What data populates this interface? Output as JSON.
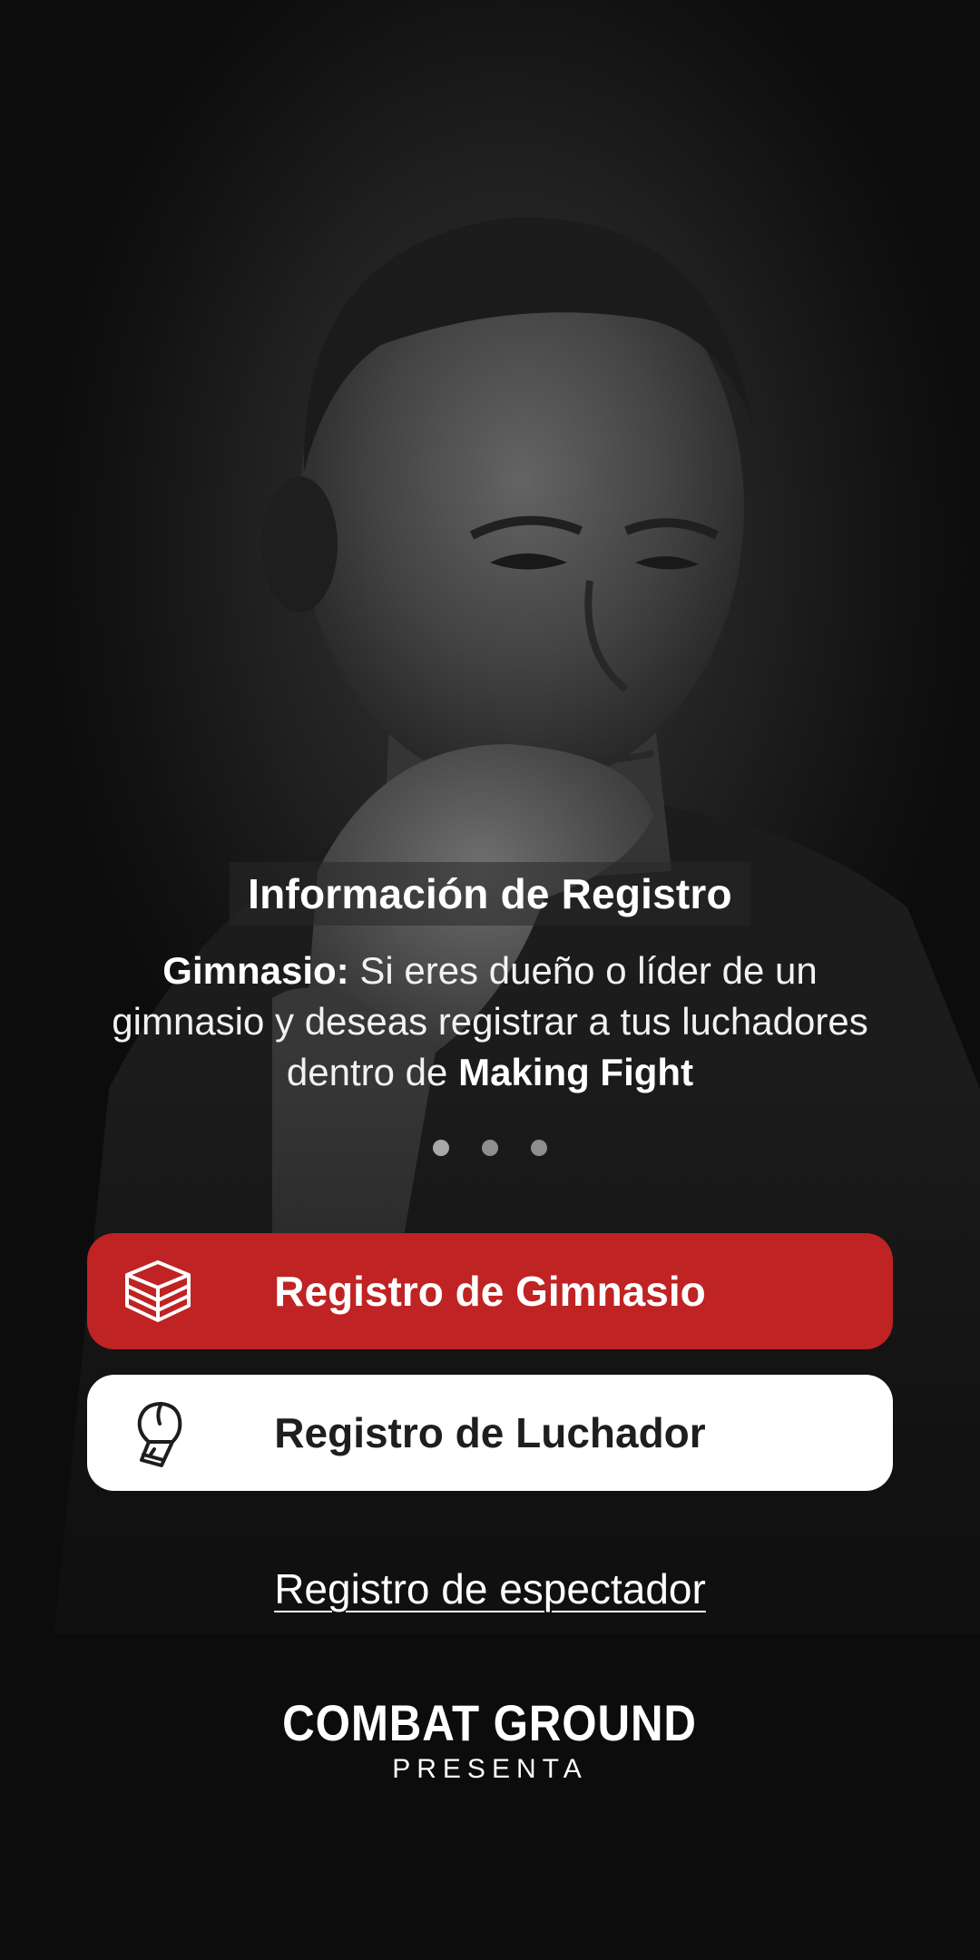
{
  "info": {
    "title": "Información de Registro",
    "body_bold_prefix": "Gimnasio:",
    "body_text": " Si eres dueño o líder de un gimnasio y deseas registrar a tus luchadores dentro de ",
    "body_bold_suffix": "Making Fight"
  },
  "carousel": {
    "page_count": 3,
    "current_page": 1
  },
  "buttons": {
    "gym": {
      "label": "Registro de Gimnasio",
      "icon": "boxing-ring-icon",
      "color": "#bf2323"
    },
    "fighter": {
      "label": "Registro de Luchador",
      "icon": "boxing-glove-icon",
      "color": "#ffffff"
    }
  },
  "spectator_link": "Registro de espectador",
  "brand": {
    "name": "COMBAT GROUND",
    "subtitle": "PRESENTA"
  }
}
